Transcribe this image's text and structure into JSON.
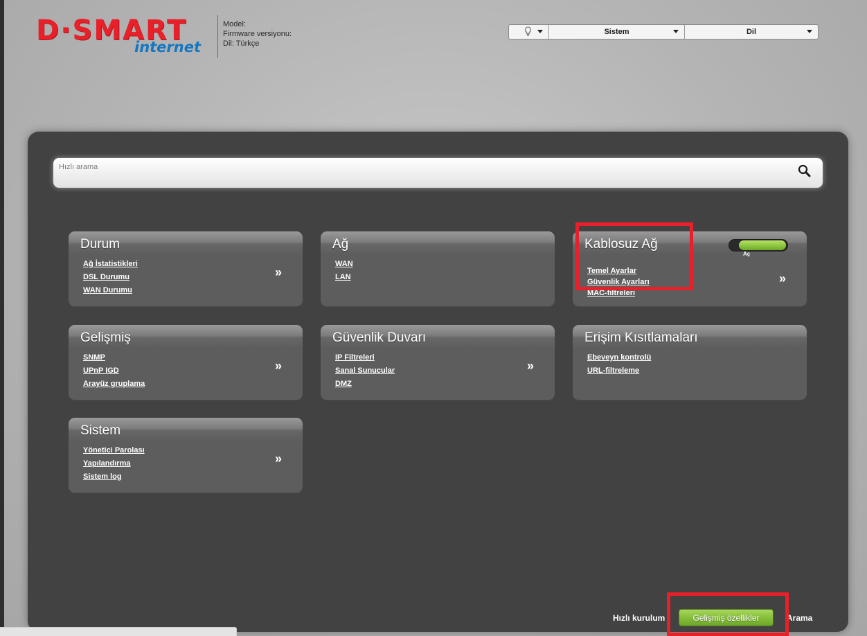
{
  "header": {
    "logo": {
      "main": "D·SMART",
      "sub": "internet"
    },
    "device_info": {
      "model": "Model:",
      "firmware": "Firmware versiyonu:",
      "language": "Dil: Türkçe"
    },
    "topbar": {
      "system_label": "Sistem",
      "language_label": "Dil"
    }
  },
  "search": {
    "placeholder": "Hızlı arama"
  },
  "cards": {
    "durum": {
      "title": "Durum",
      "links": [
        "Ağ İstatistikleri",
        "DSL Durumu",
        "WAN Durumu"
      ],
      "arrow": "»"
    },
    "ag": {
      "title": "Ağ",
      "links": [
        "WAN",
        "LAN"
      ]
    },
    "kablosuz": {
      "title": "Kablosuz Ağ",
      "links": [
        "Temel Ayarlar",
        "Güvenlik Ayarları",
        "MAC-filtreleri"
      ],
      "arrow": "»",
      "toggle": {
        "label": "Aç",
        "state": "on"
      }
    },
    "gelismis": {
      "title": "Gelişmiş",
      "links": [
        "SNMP",
        "UPnP IGD",
        "Arayüz gruplama"
      ],
      "arrow": "»"
    },
    "guvenlik": {
      "title": "Güvenlik Duvarı",
      "links": [
        "IP Filtreleri",
        "Sanal Sunucular",
        "DMZ"
      ],
      "arrow": "»"
    },
    "erisim": {
      "title": "Erişim Kısıtlamaları",
      "links": [
        "Ebeveyn kontrolü",
        "URL-filtreleme"
      ]
    },
    "sistem": {
      "title": "Sistem",
      "links": [
        "Yönetici Parolası",
        "Yapılandırma",
        "Sistem log"
      ],
      "arrow": "»"
    }
  },
  "footer": {
    "quick_setup": "Hızlı kurulum",
    "advanced": "Gelişmiş özellikler",
    "search": "Arama"
  },
  "colors": {
    "brand_red": "#e8202a",
    "brand_blue": "#1577c2",
    "panel": "#424242",
    "card": "#5d5d5d",
    "toggle_green": "#8cc63e",
    "highlight": "#e8202a"
  }
}
